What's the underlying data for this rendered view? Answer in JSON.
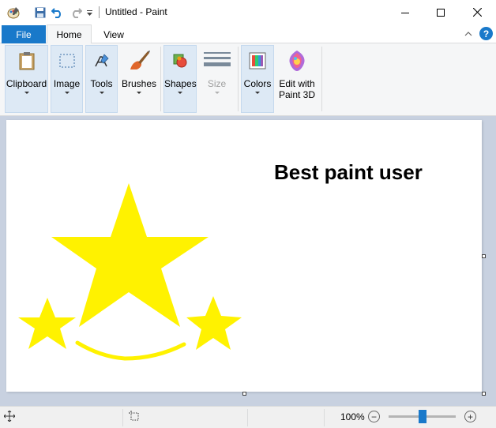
{
  "window": {
    "title": "Untitled - Paint"
  },
  "tabs": {
    "file": "File",
    "home": "Home",
    "view": "View"
  },
  "ribbon": {
    "clipboard": "Clipboard",
    "image": "Image",
    "tools": "Tools",
    "brushes": "Brushes",
    "shapes": "Shapes",
    "size": "Size",
    "colors": "Colors",
    "edit3d_line1": "Edit with",
    "edit3d_line2": "Paint 3D"
  },
  "canvas": {
    "text": "Best paint user",
    "star_color": "#ffee00",
    "text_color": "#000000"
  },
  "status": {
    "zoom": "100%",
    "zoom_out": "−",
    "zoom_in": "+"
  },
  "colors": {
    "accent": "#1979ca",
    "ribbon_bg": "#f5f6f7",
    "group_bg": "#dde9f5",
    "workspace_bg": "#c8d1e0"
  },
  "icons": [
    "paint-app-icon",
    "save-icon",
    "undo-icon",
    "redo-icon",
    "customize-dropdown-icon",
    "minimize-icon",
    "maximize-icon",
    "close-icon",
    "collapse-ribbon-icon",
    "help-icon",
    "clipboard-icon",
    "select-image-icon",
    "tools-icon",
    "brush-icon",
    "shapes-icon",
    "size-icon",
    "colors-icon",
    "paint3d-icon",
    "move-cursor-icon",
    "selection-size-icon"
  ]
}
